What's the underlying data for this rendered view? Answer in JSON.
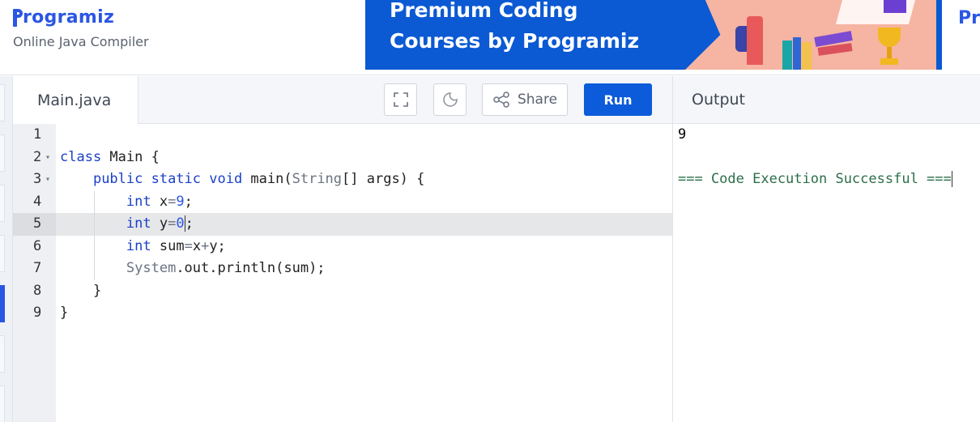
{
  "brand": {
    "logo_text": "rogramiz",
    "subtitle": "Online Java Compiler"
  },
  "banner": {
    "line1": "Premium Coding",
    "line2": "Courses by Programiz",
    "right_logo_text": "Pro"
  },
  "editor": {
    "file_tab": "Main.java",
    "share_label": "Share",
    "run_label": "Run",
    "lines": [
      {
        "num": "1",
        "fold": ""
      },
      {
        "num": "2",
        "fold": "▾"
      },
      {
        "num": "3",
        "fold": "▾"
      },
      {
        "num": "4",
        "fold": ""
      },
      {
        "num": "5",
        "fold": ""
      },
      {
        "num": "6",
        "fold": ""
      },
      {
        "num": "7",
        "fold": ""
      },
      {
        "num": "8",
        "fold": ""
      },
      {
        "num": "9",
        "fold": ""
      }
    ],
    "code": {
      "l2_kw": "class",
      "l2_rest": " Main {",
      "l3_kw": "public static void",
      "l3_rest": " main(",
      "l3_type": "String",
      "l3_tail": "[] args) {",
      "l4_kw": "int",
      "l4_var": " x",
      "l4_op": "=",
      "l4_num": "9",
      "l4_end": ";",
      "l5_kw": "int",
      "l5_var": " y",
      "l5_op": "=",
      "l5_num": "0",
      "l5_end": ";",
      "l6_kw": "int",
      "l6_var": " sum",
      "l6_op": "=",
      "l6_a": "x",
      "l6_plus": "+",
      "l6_b": "y;",
      "l7_sys": "System",
      "l7_rest": ".out.println(sum);",
      "l8": "}",
      "l9": "}"
    },
    "active_line": 5
  },
  "output": {
    "title": "Output",
    "lines": [
      "9",
      "",
      "=== Code Execution Successful ==="
    ]
  },
  "colors": {
    "accent": "#2a56e4",
    "run_button": "#0b5bdb",
    "banner_bg": "#0b59d3",
    "keyword": "#1a3fc7",
    "success_text": "#2c6e4a"
  },
  "icons": {
    "fullscreen": "fullscreen-icon",
    "theme": "moon-icon",
    "share": "share-icon"
  }
}
